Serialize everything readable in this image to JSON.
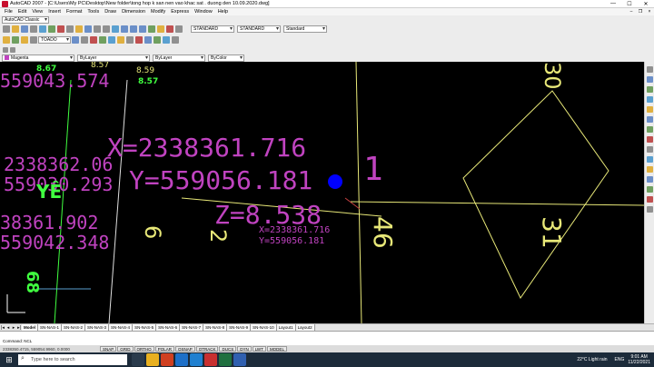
{
  "window": {
    "title": "AutoCAD 2007 - [C:\\Users\\My PC\\Desktop\\New folder\\tong hop k san nen vao khac sat . duong den 10.09.2020.dwg]",
    "minimize": "—",
    "maximize": "☐",
    "close": "✕"
  },
  "menu": [
    "File",
    "Edit",
    "View",
    "Insert",
    "Format",
    "Tools",
    "Draw",
    "Dimension",
    "Modify",
    "Express",
    "Window",
    "Help"
  ],
  "workspace": "AutoCAD Classic",
  "styles": {
    "text_style": "STANDARD",
    "dim_style": "STANDARD",
    "table_style": "Standard"
  },
  "layer": {
    "current": "TOADO"
  },
  "properties": {
    "color": "Magenta",
    "linetype": "ByLayer",
    "lineweight": "ByLayer",
    "plotstyle": "ByColor"
  },
  "drawing": {
    "x_label": "X=2338361.716",
    "y_label": "Y=559056.181",
    "z_label": "Z=8.538",
    "small_x": "X=2338361.716",
    "small_y": "Y=559056.181",
    "left_a": "2338362.06",
    "left_b": "559030.293",
    "left_c": "38361.902",
    "left_d": "559042.348",
    "top_a": "559043.574",
    "top_b": "8.67",
    "top_c": "8.57",
    "top_d": "8.59",
    "top_e": "8.57",
    "num_1": "1",
    "num_46": "46",
    "num_31": "31",
    "num_30": "30",
    "num_6": "6",
    "num_2": "2",
    "num_68": "68",
    "vye": "YÊ"
  },
  "tabs": [
    "Model",
    "SN-NAS-1",
    "SN-NAS-2",
    "SN-NAS-3",
    "SN-NAS-4",
    "SN-NAS-5",
    "SN-NAS-6",
    "SN-NAS-7",
    "SN-NAS-8",
    "SN-NAS-9",
    "SN-NAS-10",
    "Layout1",
    "Layout2"
  ],
  "command": {
    "prompt": "Command: NCL"
  },
  "status": {
    "coords": "2338350.4715, 559054.9960, 0.0000",
    "toggles": [
      "SNAP",
      "GRID",
      "ORTHO",
      "POLAR",
      "OSNAP",
      "OTRACK",
      "DUCS",
      "DYN",
      "LWT",
      "MODEL"
    ]
  },
  "taskbar": {
    "search_placeholder": "Type here to search",
    "weather": "22°C  Light rain",
    "lang": "ENG",
    "time": "9:01 AM",
    "date": "11/22/2021"
  },
  "colors": {
    "magenta": "#c043c0",
    "green": "#40ff40",
    "yellow": "#e8e878",
    "blue_marker": "#0000ff"
  }
}
